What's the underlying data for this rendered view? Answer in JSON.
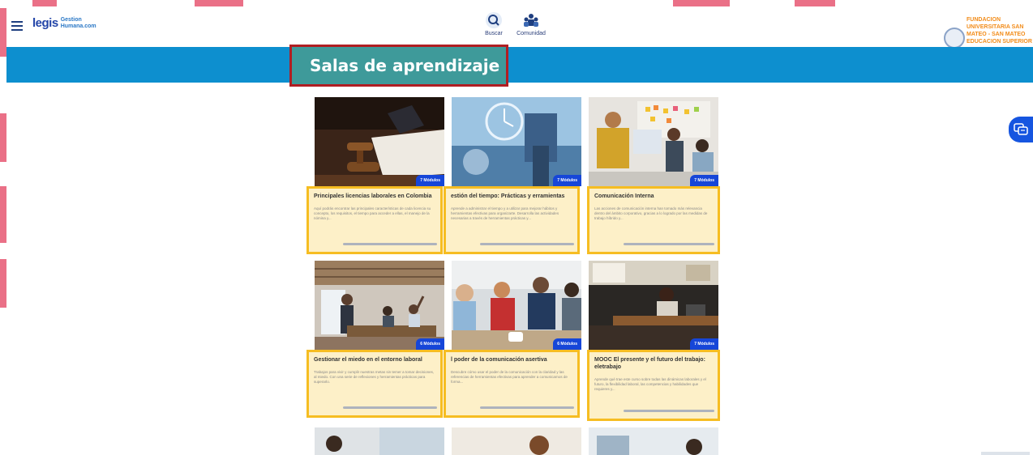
{
  "header": {
    "logo_main": "legis",
    "logo_sub_1": "Gestion",
    "logo_sub_2": "Humana.com",
    "nav": [
      {
        "label": "Buscar",
        "icon": "search-icon"
      },
      {
        "label": "Comunidad",
        "icon": "community-icon"
      }
    ],
    "organization": "FUNDACION UNIVERSITARIA SAN MATEO - SAN MATEO EDUCACION SUPERIOR"
  },
  "banner": {
    "title": "Salas de aprendizaje"
  },
  "cards": [
    {
      "badge": "7 Módulos",
      "title": "Principales licencias laborales en Colombia",
      "description": "Aquí podrás encontrar las principales características de cada licencia su concepto, los requisitos, el tiempo para acceder a ellas, el manejo de la nómina y..."
    },
    {
      "badge": "7 Módulos",
      "title": "estión del tiempo: Prácticas y erramientas",
      "description": "Aprende a administrar el tiempo y a utilizar para mejorar hábitos y herramientas efectivas para organizarte. Desarrolla las actividades necesarias a través de herramientas prácticas y..."
    },
    {
      "badge": "7 Módulos",
      "title": "Comunicación Interna",
      "description": "Las acciones de comunicación interna han tomado más relevancia dentro del ámbito corporativo, gracias a lo logrado por las medidas de trabajo híbrido y..."
    },
    {
      "badge": "6 Módulos",
      "title": "Gestionar el miedo en el entorno laboral",
      "description": "Trabajos para vivir y cumplir nuestras metas sin temer a tomar decisiones, al miedo. Con una serie de reflexiones y herramientas prácticas para superarlo."
    },
    {
      "badge": "6 Módulos",
      "title": "l poder de la comunicación asertiva",
      "description": "Descubre cómo usar el poder de la comunicación con la claridad y las referencias de herramientas efectivas para aprender a comunicarnos de forma..."
    },
    {
      "badge": "7 Módulos",
      "title": "MOOC El presente y el futuro del trabajo: eletrabajo",
      "description": "Aprende qué trae este curso sobre todas las dinámicas laborales y el futuro, la flexibilidad laboral, las competencias y habilidades que requieres y..."
    }
  ],
  "colors": {
    "banner": "#0d8fcf",
    "title_box": "#3e9a9a",
    "highlight_title": "#b01e22",
    "highlight_cards": "#f6bd22",
    "badge": "#1646d8"
  }
}
